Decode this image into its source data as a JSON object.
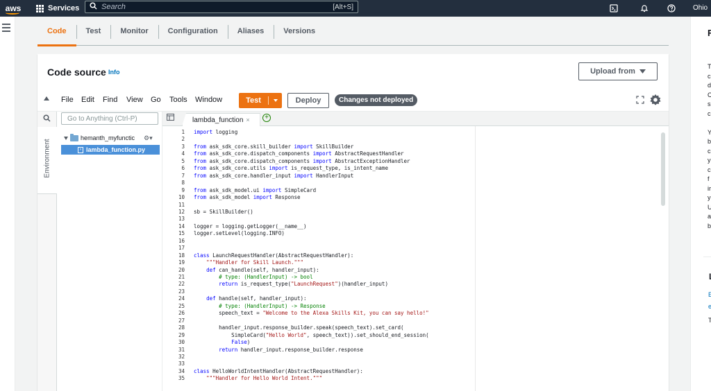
{
  "topnav": {
    "logo": "aws",
    "services_label": "Services",
    "search_placeholder": "Search",
    "search_shortcut": "[Alt+S]",
    "region": "Ohio"
  },
  "tabs": [
    "Code",
    "Test",
    "Monitor",
    "Configuration",
    "Aliases",
    "Versions"
  ],
  "active_tab": "Code",
  "code_source": {
    "title": "Code source",
    "info": "Info",
    "upload_label": "Upload from"
  },
  "ide_menu": [
    "File",
    "Edit",
    "Find",
    "View",
    "Go",
    "Tools",
    "Window"
  ],
  "toolbar": {
    "test_label": "Test",
    "deploy_label": "Deploy",
    "status_badge": "Changes not deployed"
  },
  "environment": {
    "tab_label": "Environment",
    "goto_placeholder": "Go to Anything (Ctrl-P)",
    "folder_name": "hemanth_myfunctic",
    "file_name": "lambda_function.py"
  },
  "editor": {
    "open_tab": "lambda_function",
    "lines": [
      "import logging",
      "",
      "from ask_sdk_core.skill_builder import SkillBuilder",
      "from ask_sdk_core.dispatch_components import AbstractRequestHandler",
      "from ask_sdk_core.dispatch_components import AbstractExceptionHandler",
      "from ask_sdk_core.utils import is_request_type, is_intent_name",
      "from ask_sdk_core.handler_input import HandlerInput",
      "",
      "from ask_sdk_model.ui import SimpleCard",
      "from ask_sdk_model import Response",
      "",
      "sb = SkillBuilder()",
      "",
      "logger = logging.getLogger(__name__)",
      "logger.setLevel(logging.INFO)",
      "",
      "",
      "class LaunchRequestHandler(AbstractRequestHandler):",
      "    \"\"\"Handler for Skill Launch.\"\"\"",
      "    def can_handle(self, handler_input):",
      "        # type: (HandlerInput) -> bool",
      "        return is_request_type(\"LaunchRequest\")(handler_input)",
      "",
      "    def handle(self, handler_input):",
      "        # type: (HandlerInput) -> Response",
      "        speech_text = \"Welcome to the Alexa Skills Kit, you can say hello!\"",
      "",
      "        handler_input.response_builder.speak(speech_text).set_card(",
      "            SimpleCard(\"Hello World\", speech_text)).set_should_end_session(",
      "            False)",
      "        return handler_input.response_builder.response",
      "",
      "",
      "class HelloWorldIntentHandler(AbstractRequestHandler):",
      "    \"\"\"Handler for Hello World Intent.\"\"\""
    ]
  },
  "right_panel": {
    "title": "F",
    "lines": [
      "T",
      "c",
      "d",
      "C",
      "s",
      "c",
      "",
      "Y",
      "b",
      "c",
      "y",
      "c",
      "f",
      "ir",
      "y",
      "U",
      "a",
      "b"
    ],
    "learn_title": "L",
    "learn_links": [
      "E",
      "e"
    ],
    "learn_text": "T"
  }
}
